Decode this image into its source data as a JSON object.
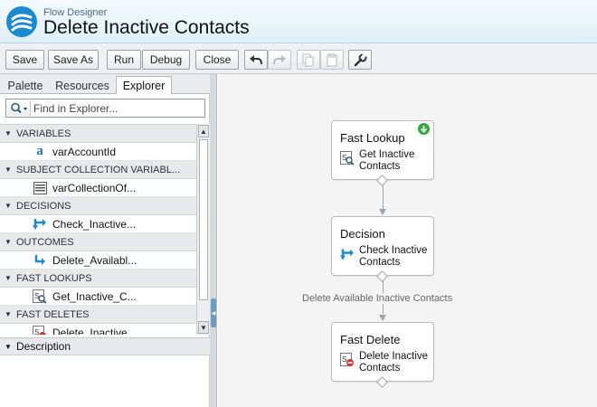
{
  "header": {
    "app_name": "Flow Designer",
    "title": "Delete Inactive Contacts"
  },
  "toolbar": {
    "save": "Save",
    "save_as": "Save As",
    "run": "Run",
    "debug": "Debug",
    "close": "Close",
    "undo_icon": "undo-icon",
    "redo_icon": "redo-icon",
    "copy_icon": "copy-icon",
    "paste_icon": "paste-icon",
    "settings_icon": "wrench-icon"
  },
  "left_panel": {
    "tabs": [
      "Palette",
      "Resources",
      "Explorer"
    ],
    "active_tab": "Explorer",
    "search": {
      "placeholder": "Find in Explorer..."
    },
    "sections": [
      {
        "label": "VARIABLES",
        "items": [
          {
            "label": "varAccountId",
            "icon": "text-variable-icon"
          }
        ]
      },
      {
        "label": "SUBJECT COLLECTION VARIABL...",
        "items": [
          {
            "label": "varCollectionOf...",
            "icon": "collection-icon"
          }
        ]
      },
      {
        "label": "DECISIONS",
        "items": [
          {
            "label": "Check_Inactive...",
            "icon": "decision-icon"
          }
        ]
      },
      {
        "label": "OUTCOMES",
        "items": [
          {
            "label": "Delete_Availabl...",
            "icon": "outcome-icon"
          }
        ]
      },
      {
        "label": "FAST LOOKUPS",
        "items": [
          {
            "label": "Get_Inactive_C...",
            "icon": "fast-lookup-icon"
          }
        ]
      },
      {
        "label": "FAST DELETES",
        "items": [
          {
            "label": "Delete_Inactive...",
            "icon": "fast-delete-icon"
          }
        ]
      }
    ],
    "description_label": "Description"
  },
  "canvas": {
    "nodes": [
      {
        "type": "Fast Lookup",
        "name_line1": "Get Inactive",
        "name_line2": "Contacts",
        "icon": "fast-lookup-icon",
        "start": true
      },
      {
        "type": "Decision",
        "name_line1": "Check Inactive",
        "name_line2": "Contacts",
        "icon": "decision-icon"
      },
      {
        "type": "Fast Delete",
        "name_line1": "Delete Inactive",
        "name_line2": "Contacts",
        "icon": "fast-delete-icon"
      }
    ],
    "connector_label": "Delete Available Inactive Contacts"
  },
  "colors": {
    "accent": "#1b8ad3",
    "start_badge": "#2ea83a",
    "canvas_bg": "#f4f4f4"
  }
}
